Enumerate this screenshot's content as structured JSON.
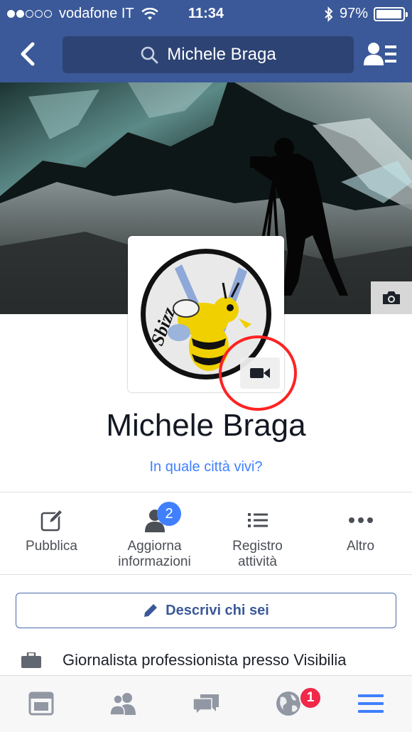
{
  "status_bar": {
    "carrier": "vodafone IT",
    "time": "11:34",
    "battery": "97%",
    "battery_level": 0.97,
    "signal_bars_filled": 2,
    "signal_bars_total": 5
  },
  "header": {
    "search_text": "Michele Braga",
    "back_icon": "chevron-left-icon",
    "friends_icon": "friend-requests-icon",
    "bar_color": "#3b5998"
  },
  "cover": {
    "camera_icon": "camera-icon"
  },
  "profile": {
    "name": "Michele Braga",
    "city_prompt": "In quale città vivi?",
    "avatar_text": "Sbizz",
    "video_icon": "video-camera-icon"
  },
  "actions": [
    {
      "label": "Pubblica",
      "icon": "edit-icon"
    },
    {
      "label_line1": "Aggiorna",
      "label_line2": "informazioni",
      "icon": "person-icon",
      "badge": "2"
    },
    {
      "label_line1": "Registro",
      "label_line2": "attività",
      "icon": "list-icon"
    },
    {
      "label": "Altro",
      "icon": "more-icon"
    }
  ],
  "describe": {
    "label": "Descrivi chi sei",
    "icon": "pencil-icon"
  },
  "job": {
    "text": "Giornalista professionista presso Visibilia",
    "icon": "briefcase-icon"
  },
  "tabbar": {
    "items": [
      "news-feed-icon",
      "friends-icon",
      "messages-icon",
      "globe-icon",
      "menu-icon"
    ],
    "notifications_badge": "1",
    "accent": "#4080ff"
  }
}
